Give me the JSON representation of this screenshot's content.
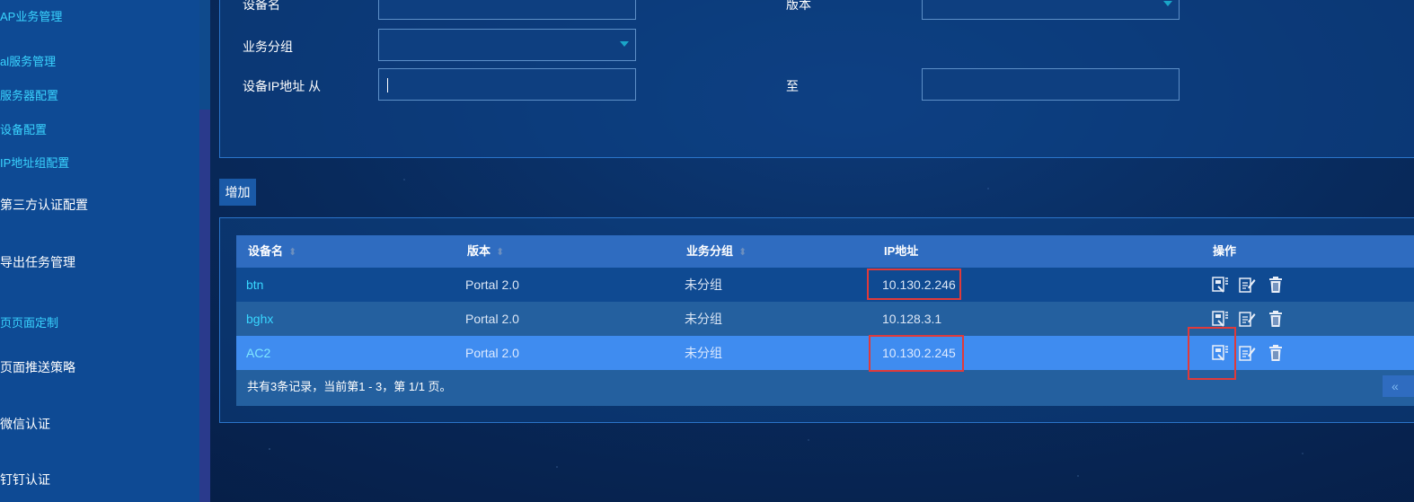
{
  "sidebar": {
    "items": [
      {
        "label": "AP业务管理",
        "kind": "sub"
      },
      {
        "label": "al服务管理",
        "kind": "sub"
      },
      {
        "label": "服务器配置",
        "kind": "sub"
      },
      {
        "label": "设备配置",
        "kind": "sub"
      },
      {
        "label": "IP地址组配置",
        "kind": "sub"
      },
      {
        "label": "第三方认证配置",
        "kind": "top"
      },
      {
        "label": "导出任务管理",
        "kind": "top"
      },
      {
        "label": "页页面定制",
        "kind": "sub"
      },
      {
        "label": "页面推送策略",
        "kind": "top"
      },
      {
        "label": "微信认证",
        "kind": "top"
      },
      {
        "label": "钉钉认证",
        "kind": "top"
      }
    ]
  },
  "filter": {
    "device_name_label": "设备名",
    "version_label": "版本",
    "group_label": "业务分组",
    "ip_from_label": "设备IP地址 从",
    "ip_to_label": "至",
    "device_name_value": "",
    "version_value": "",
    "group_value": "",
    "ip_from_value": "",
    "ip_to_value": ""
  },
  "toolbar": {
    "add_label": "增加"
  },
  "table": {
    "headers": {
      "name": "设备名",
      "version": "版本",
      "group": "业务分组",
      "ip": "IP地址",
      "ops": "操作"
    },
    "rows": [
      {
        "name": "btn",
        "version": "Portal 2.0",
        "group": "未分组",
        "ip": "10.130.2.246"
      },
      {
        "name": "bghx",
        "version": "Portal 2.0",
        "group": "未分组",
        "ip": "10.128.3.1"
      },
      {
        "name": "AC2",
        "version": "Portal 2.0",
        "group": "未分组",
        "ip": "10.130.2.245"
      }
    ],
    "footer": "共有3条记录，当前第1 - 3，第 1/1 页。",
    "prev_page_icon": "«"
  },
  "icons": {
    "sort": "sort-arrows-icon",
    "config": "device-config-icon",
    "edit": "edit-icon",
    "delete": "trash-icon"
  },
  "colors": {
    "accent_cyan": "#38d6ff",
    "selected_row": "#3f8cf0",
    "highlight_box": "#e03a3a"
  }
}
